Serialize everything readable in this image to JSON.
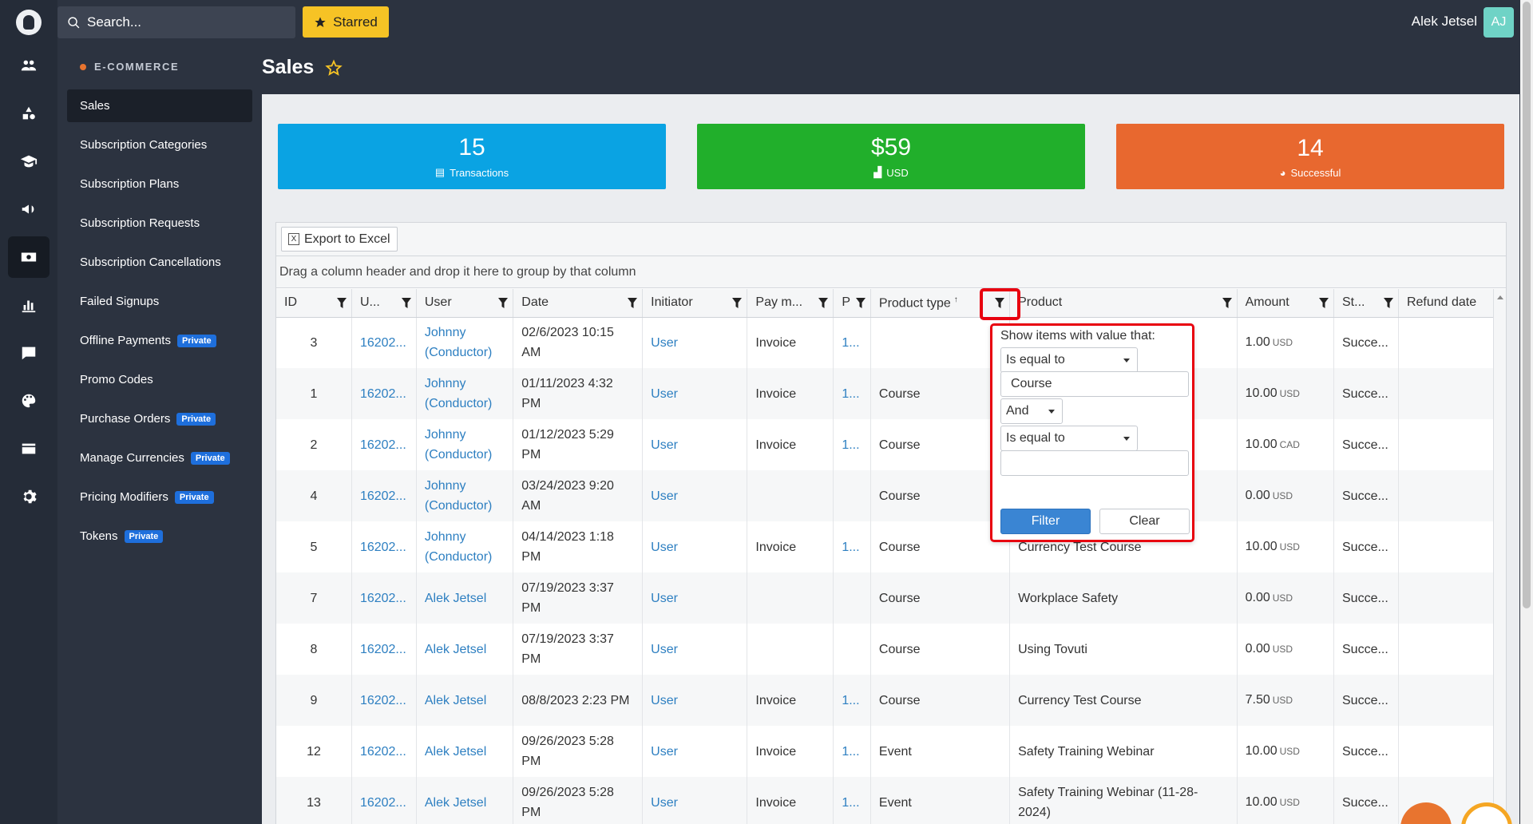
{
  "rail": {
    "icons": [
      "users-icon",
      "shapes-icon",
      "graduation-cap-icon",
      "megaphone-icon",
      "money-icon",
      "chart-icon",
      "chat-icon",
      "palette-icon",
      "card-icon",
      "gear-icon"
    ],
    "active_index": 4
  },
  "header": {
    "search_placeholder": "Search...",
    "starred_label": "Starred",
    "user_name": "Alek Jetsel",
    "avatar_initials": "AJ"
  },
  "sidebar": {
    "section": "E-COMMERCE",
    "private_badge": "Private",
    "items": [
      {
        "label": "Sales",
        "active": true,
        "private": false
      },
      {
        "label": "Subscription Categories",
        "active": false,
        "private": false
      },
      {
        "label": "Subscription Plans",
        "active": false,
        "private": false
      },
      {
        "label": "Subscription Requests",
        "active": false,
        "private": false
      },
      {
        "label": "Subscription Cancellations",
        "active": false,
        "private": false
      },
      {
        "label": "Failed Signups",
        "active": false,
        "private": false
      },
      {
        "label": "Offline Payments",
        "active": false,
        "private": true
      },
      {
        "label": "Promo Codes",
        "active": false,
        "private": false
      },
      {
        "label": "Purchase Orders",
        "active": false,
        "private": true
      },
      {
        "label": "Manage Currencies",
        "active": false,
        "private": true
      },
      {
        "label": "Pricing Modifiers",
        "active": false,
        "private": true
      },
      {
        "label": "Tokens",
        "active": false,
        "private": true
      }
    ]
  },
  "page": {
    "title": "Sales"
  },
  "stats": [
    {
      "value": "15",
      "label": "Transactions",
      "color": "#0aa3e3",
      "icon": "list-icon"
    },
    {
      "value": "$59",
      "label": "USD",
      "color": "#21af2b",
      "icon": "bar-chart-icon"
    },
    {
      "value": "14",
      "label": "Successful",
      "color": "#e8682f",
      "icon": "pie-icon"
    }
  ],
  "grid": {
    "export_label": "Export to Excel",
    "group_hint": "Drag a column header and drop it here to group by that column",
    "columns": [
      "ID",
      "U...",
      "User",
      "Date",
      "Initiator",
      "Pay m...",
      "P",
      "Product type",
      "Product",
      "Amount",
      "St...",
      "Refund date"
    ],
    "sort_indicator": "↑",
    "rows": [
      {
        "id": "3",
        "u": "16202...",
        "user": "Johnny (Conductor)",
        "date": "02/6/2023 10:15 AM",
        "initiator": "User",
        "pay": "Invoice",
        "p": "1...",
        "ptype": "",
        "product": "",
        "amount": "1.00",
        "cur": "USD",
        "status": "Succe...",
        "refund": ""
      },
      {
        "id": "1",
        "u": "16202...",
        "user": "Johnny (Conductor)",
        "date": "01/11/2023 4:32 PM",
        "initiator": "User",
        "pay": "Invoice",
        "p": "1...",
        "ptype": "Course",
        "product": "",
        "amount": "10.00",
        "cur": "USD",
        "status": "Succe...",
        "refund": ""
      },
      {
        "id": "2",
        "u": "16202...",
        "user": "Johnny (Conductor)",
        "date": "01/12/2023 5:29 PM",
        "initiator": "User",
        "pay": "Invoice",
        "p": "1...",
        "ptype": "Course",
        "product": "",
        "amount": "10.00",
        "cur": "CAD",
        "status": "Succe...",
        "refund": ""
      },
      {
        "id": "4",
        "u": "16202...",
        "user": "Johnny (Conductor)",
        "date": "03/24/2023 9:20 AM",
        "initiator": "User",
        "pay": "",
        "p": "",
        "ptype": "Course",
        "product": "",
        "amount": "0.00",
        "cur": "USD",
        "status": "Succe...",
        "refund": ""
      },
      {
        "id": "5",
        "u": "16202...",
        "user": "Johnny (Conductor)",
        "date": "04/14/2023 1:18 PM",
        "initiator": "User",
        "pay": "Invoice",
        "p": "1...",
        "ptype": "Course",
        "product": "Currency Test Course",
        "amount": "10.00",
        "cur": "USD",
        "status": "Succe...",
        "refund": ""
      },
      {
        "id": "7",
        "u": "16202...",
        "user": "Alek Jetsel",
        "date": "07/19/2023 3:37 PM",
        "initiator": "User",
        "pay": "",
        "p": "",
        "ptype": "Course",
        "product": "Workplace Safety",
        "amount": "0.00",
        "cur": "USD",
        "status": "Succe...",
        "refund": ""
      },
      {
        "id": "8",
        "u": "16202...",
        "user": "Alek Jetsel",
        "date": "07/19/2023 3:37 PM",
        "initiator": "User",
        "pay": "",
        "p": "",
        "ptype": "Course",
        "product": "Using Tovuti",
        "amount": "0.00",
        "cur": "USD",
        "status": "Succe...",
        "refund": ""
      },
      {
        "id": "9",
        "u": "16202...",
        "user": "Alek Jetsel",
        "date": "08/8/2023 2:23 PM",
        "initiator": "User",
        "pay": "Invoice",
        "p": "1...",
        "ptype": "Course",
        "product": "Currency Test Course",
        "amount": "7.50",
        "cur": "USD",
        "status": "Succe...",
        "refund": ""
      },
      {
        "id": "12",
        "u": "16202...",
        "user": "Alek Jetsel",
        "date": "09/26/2023 5:28 PM",
        "initiator": "User",
        "pay": "Invoice",
        "p": "1...",
        "ptype": "Event",
        "product": "Safety Training Webinar",
        "amount": "10.00",
        "cur": "USD",
        "status": "Succe...",
        "refund": ""
      },
      {
        "id": "13",
        "u": "16202...",
        "user": "Alek Jetsel",
        "date": "09/26/2023 5:28 PM",
        "initiator": "User",
        "pay": "Invoice",
        "p": "1...",
        "ptype": "Event",
        "product": "Safety Training Webinar (11-28-2024)",
        "amount": "10.00",
        "cur": "USD",
        "status": "Succe...",
        "refund": ""
      }
    ]
  },
  "filter": {
    "title": "Show items with value that:",
    "operator1": "Is equal to",
    "value1": "Course",
    "logic": "And",
    "operator2": "Is equal to",
    "value2": "",
    "filter_label": "Filter",
    "clear_label": "Clear"
  }
}
